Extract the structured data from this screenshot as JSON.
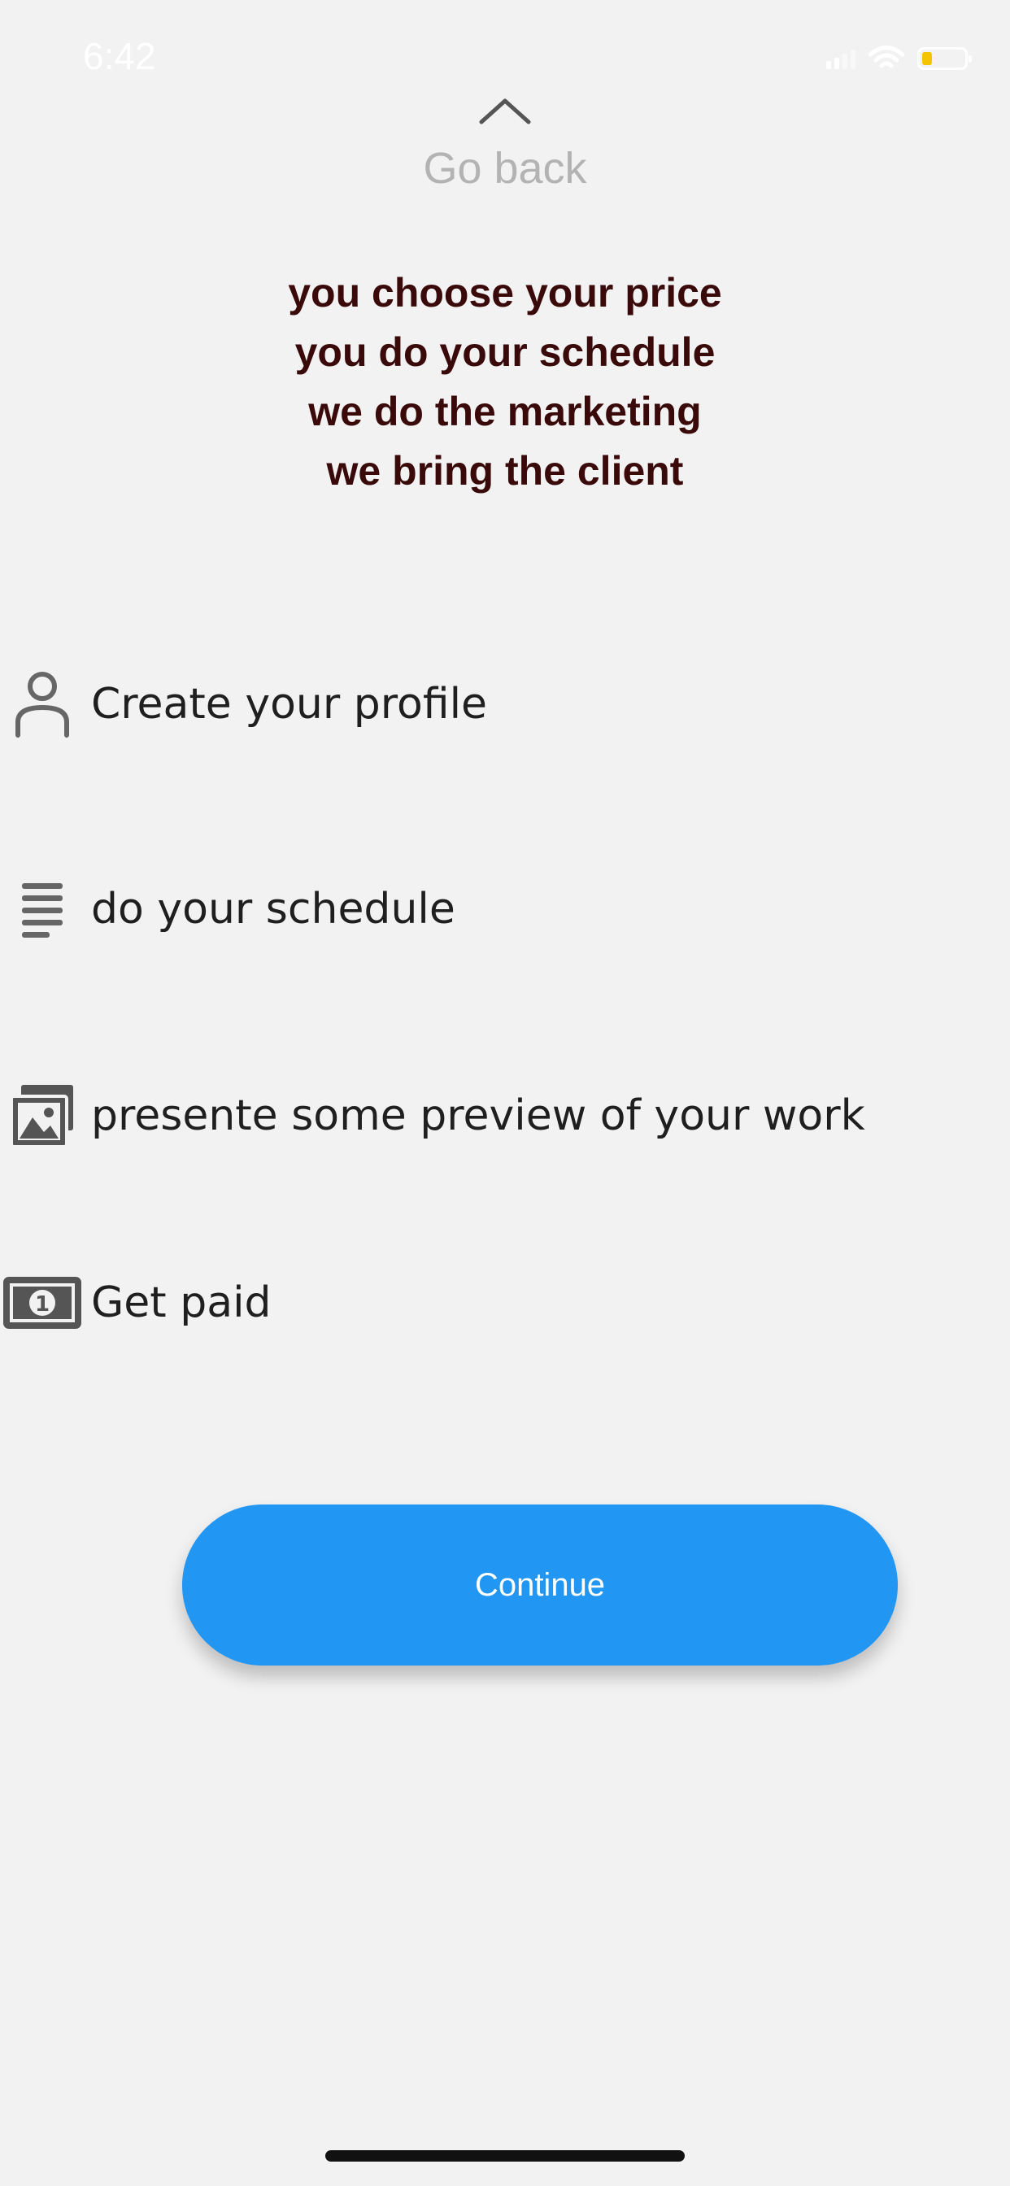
{
  "status_bar": {
    "time": "6:42",
    "battery_color": "#f5c400"
  },
  "nav": {
    "go_back_label": "Go back",
    "icon": "chevron-up-icon"
  },
  "tagline": {
    "color": "#3a0a0a",
    "lines": [
      "you choose your price",
      "you do your schedule",
      "we do the marketing",
      "we bring the client"
    ]
  },
  "features": [
    {
      "icon": "user-icon",
      "label": "Create your profile"
    },
    {
      "icon": "list-icon",
      "label": "do your schedule"
    },
    {
      "icon": "images-icon",
      "label": "presente some preview of your work"
    },
    {
      "icon": "money-bill-icon",
      "label": "Get paid"
    }
  ],
  "continue_button": {
    "label": "Continue",
    "color": "#2196f3"
  }
}
